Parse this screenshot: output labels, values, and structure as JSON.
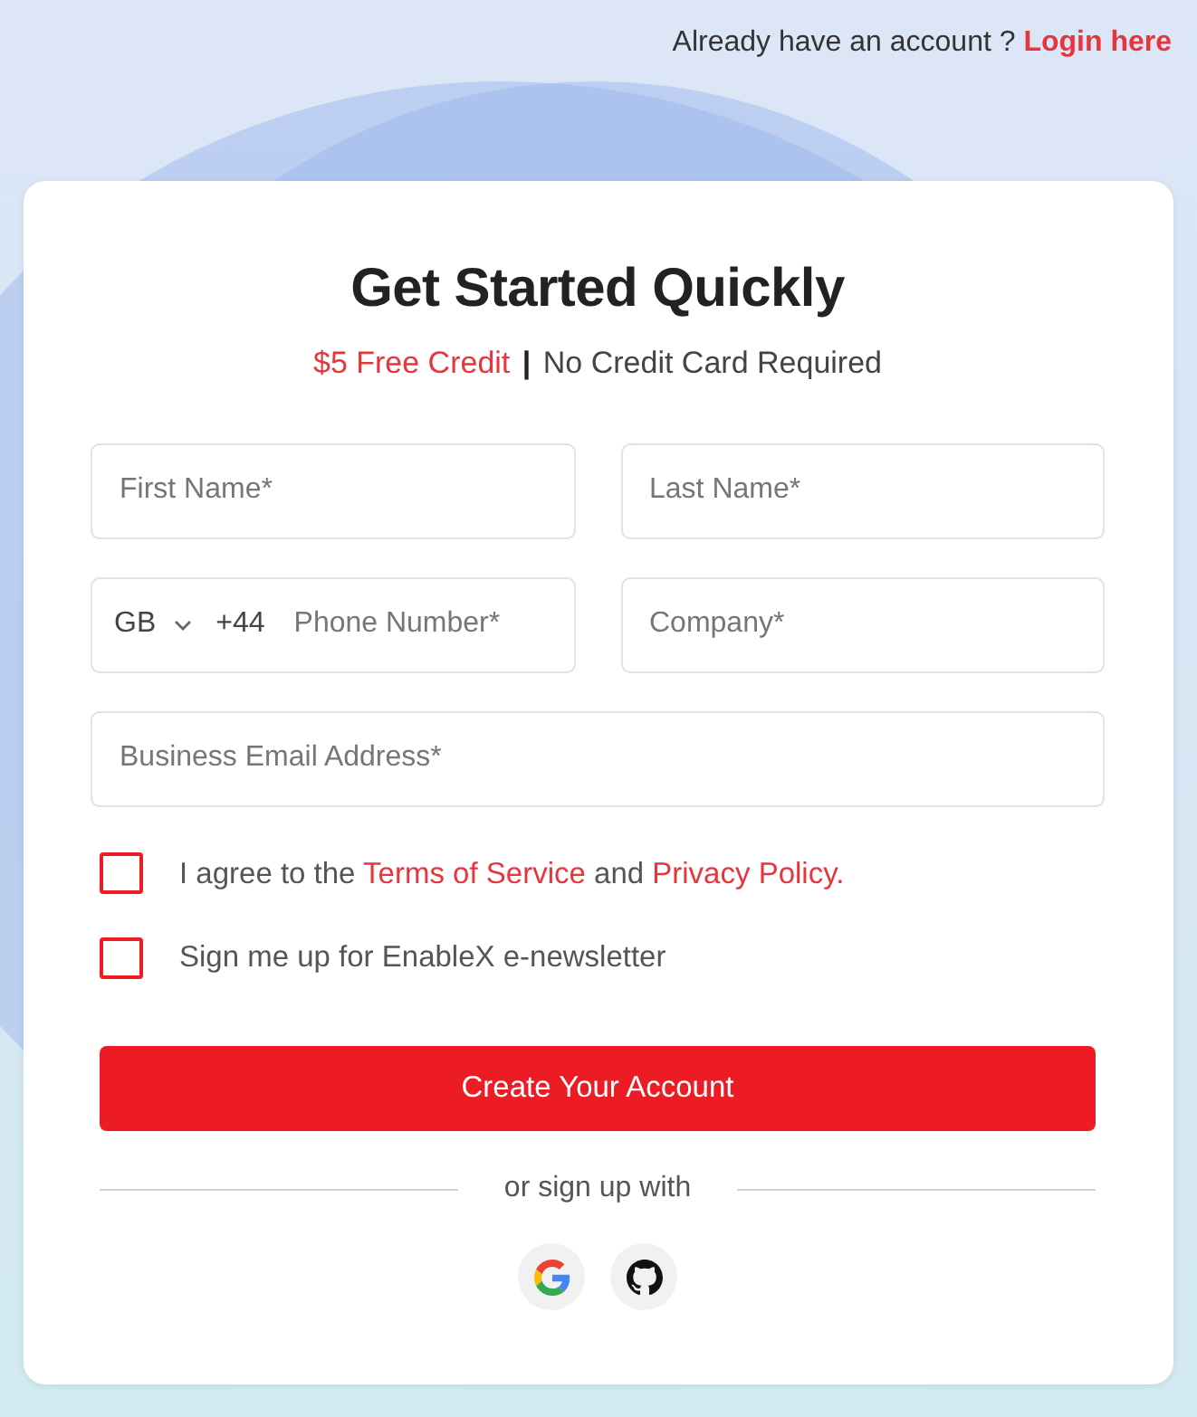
{
  "header": {
    "prompt": "Already have an account ?",
    "login_link": "Login here"
  },
  "card": {
    "title": "Get Started Quickly",
    "subtitle": {
      "highlight": "$5 Free Credit",
      "separator": "|",
      "text": "No Credit Card Required"
    }
  },
  "fields": [
    {
      "kind": "text",
      "placeholder": "First Name*",
      "wide": false
    },
    {
      "kind": "text",
      "placeholder": "Last Name*",
      "wide": false
    },
    {
      "kind": "phone",
      "country": "GB",
      "dial_code": "+44",
      "placeholder": "Phone Number*",
      "wide": false
    },
    {
      "kind": "text",
      "placeholder": "Company*",
      "wide": false
    },
    {
      "kind": "text",
      "placeholder": "Business Email Address*",
      "wide": true
    }
  ],
  "consents": [
    {
      "checked": false,
      "segments": [
        {
          "kind": "text",
          "text": "I agree to the"
        },
        {
          "kind": "link",
          "text": "Terms of Service"
        },
        {
          "kind": "text",
          "text": "and"
        },
        {
          "kind": "link",
          "text": "Privacy Policy."
        }
      ]
    },
    {
      "checked": false,
      "segments": [
        {
          "kind": "text",
          "text": "Sign me up for EnableX e-newsletter"
        }
      ]
    }
  ],
  "submit_button": "Create Your Account",
  "divider_text": "or sign up with",
  "social_buttons": [
    {
      "kind": "google"
    },
    {
      "kind": "github"
    }
  ]
}
